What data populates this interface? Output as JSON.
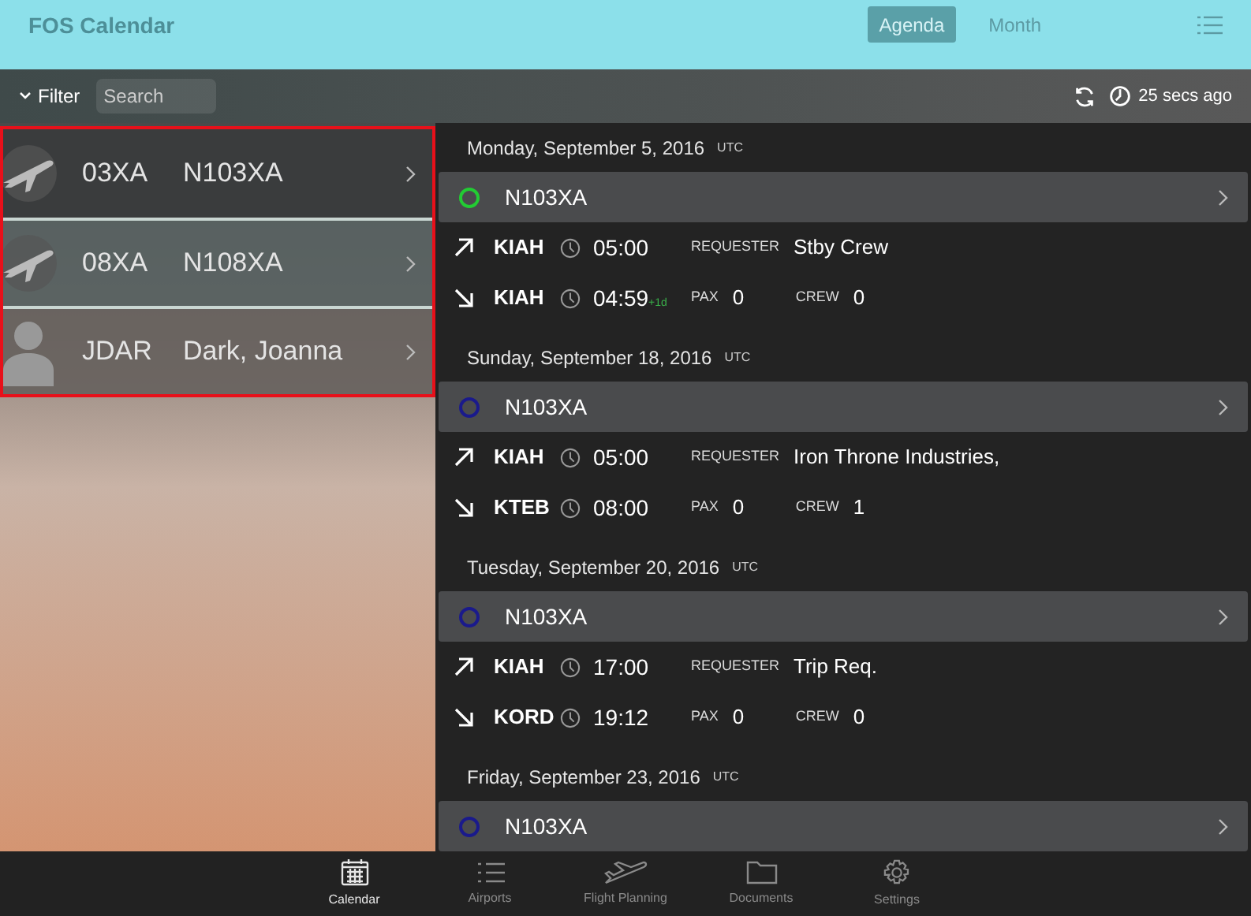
{
  "app_title": "FOS Calendar",
  "view_tabs": [
    {
      "label": "Agenda",
      "selected": true
    },
    {
      "label": "Month",
      "selected": false
    }
  ],
  "toolbar": {
    "filter": "Filter",
    "search": {
      "placeholder": "Search"
    },
    "updated": "25 secs ago"
  },
  "list": [
    {
      "kind": "aircraft",
      "code": "03XA",
      "name": "N103XA"
    },
    {
      "kind": "aircraft",
      "code": "08XA",
      "name": "N108XA"
    },
    {
      "kind": "person",
      "code": "JDAR",
      "name": "Dark, Joanna"
    }
  ],
  "agenda": [
    {
      "date": "Monday, September 5, 2016",
      "tz": "UTC",
      "trips": [
        {
          "tail": "N103XA",
          "color": "#22cc33",
          "legs": [
            {
              "kind": "departure",
              "airport": "KIAH",
              "time": "05:00",
              "fields": [
                {
                  "label": "REQUESTER",
                  "value": "Stby Crew"
                }
              ]
            },
            {
              "kind": "arrival",
              "airport": "KIAH",
              "time": "04:59",
              "day_offset": "+1d",
              "fields": [
                {
                  "label": "PAX",
                  "value": "0"
                },
                {
                  "label": "CREW",
                  "value": "0"
                }
              ]
            }
          ]
        }
      ]
    },
    {
      "date": "Sunday, September 18, 2016",
      "tz": "UTC",
      "trips": [
        {
          "tail": "N103XA",
          "color": "#1a1a8c",
          "legs": [
            {
              "kind": "departure",
              "airport": "KIAH",
              "time": "05:00",
              "fields": [
                {
                  "label": "REQUESTER",
                  "value": "Iron Throne Industries,"
                }
              ]
            },
            {
              "kind": "arrival",
              "airport": "KTEB",
              "time": "08:00",
              "fields": [
                {
                  "label": "PAX",
                  "value": "0"
                },
                {
                  "label": "CREW",
                  "value": "1"
                }
              ]
            }
          ]
        }
      ]
    },
    {
      "date": "Tuesday, September 20, 2016",
      "tz": "UTC",
      "trips": [
        {
          "tail": "N103XA",
          "color": "#1a1a8c",
          "legs": [
            {
              "kind": "departure",
              "airport": "KIAH",
              "time": "17:00",
              "fields": [
                {
                  "label": "REQUESTER",
                  "value": "Trip Req."
                }
              ]
            },
            {
              "kind": "arrival",
              "airport": "KORD",
              "time": "19:12",
              "fields": [
                {
                  "label": "PAX",
                  "value": "0"
                },
                {
                  "label": "CREW",
                  "value": "0"
                }
              ]
            }
          ]
        }
      ]
    },
    {
      "date": "Friday, September 23, 2016",
      "tz": "UTC",
      "trips": [
        {
          "tail": "N103XA",
          "color": "#1a1a8c"
        }
      ]
    }
  ],
  "tab_bar": [
    {
      "kind": "calendar",
      "label": "Calendar",
      "selected": true
    },
    {
      "kind": "list",
      "label": "Airports",
      "selected": false
    },
    {
      "kind": "plane",
      "label": "Flight Planning",
      "selected": false
    },
    {
      "kind": "folder",
      "label": "Documents",
      "selected": false
    },
    {
      "kind": "gear",
      "label": "Settings",
      "selected": false
    }
  ]
}
